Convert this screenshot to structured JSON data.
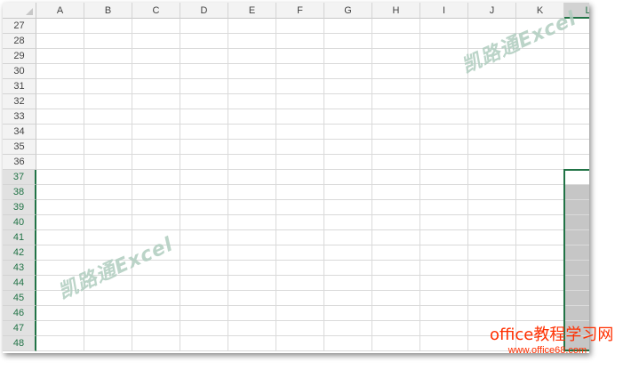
{
  "columns": [
    "A",
    "B",
    "C",
    "D",
    "E",
    "F",
    "G",
    "H",
    "I",
    "J",
    "K",
    "L"
  ],
  "selected_column": "L",
  "rows": [
    {
      "num": "27",
      "l": "3"
    },
    {
      "num": "28",
      "l": "4"
    },
    {
      "num": "29",
      "l": "5"
    },
    {
      "num": "30",
      "l": "6"
    },
    {
      "num": "31",
      "l": "7"
    },
    {
      "num": "32",
      "l": "8"
    },
    {
      "num": "33",
      "l": "9"
    },
    {
      "num": "34",
      "l": "10"
    },
    {
      "num": "35",
      "l": "11"
    },
    {
      "num": "36",
      "l": "12"
    },
    {
      "num": "37",
      "l": "1"
    },
    {
      "num": "38",
      "l": "2"
    },
    {
      "num": "39",
      "l": "3"
    },
    {
      "num": "40",
      "l": "4"
    },
    {
      "num": "41",
      "l": "5"
    },
    {
      "num": "42",
      "l": "6"
    },
    {
      "num": "43",
      "l": "7"
    },
    {
      "num": "44",
      "l": "8"
    },
    {
      "num": "45",
      "l": "9"
    },
    {
      "num": "46",
      "l": "10"
    },
    {
      "num": "47",
      "l": "11"
    },
    {
      "num": "48",
      "l": "12"
    }
  ],
  "selection": {
    "first_row": "37",
    "last_row": "48",
    "active_row": "37"
  },
  "watermarks": [
    "凯路通Excel",
    "凯路通Excel"
  ],
  "footer": {
    "title": "office教程学习网",
    "url": "www.office68.com"
  },
  "colors": {
    "accent": "#217346",
    "selection_fill": "#c6c6c6",
    "watermark": "#afcdbe",
    "footer": "#ff2f00"
  }
}
